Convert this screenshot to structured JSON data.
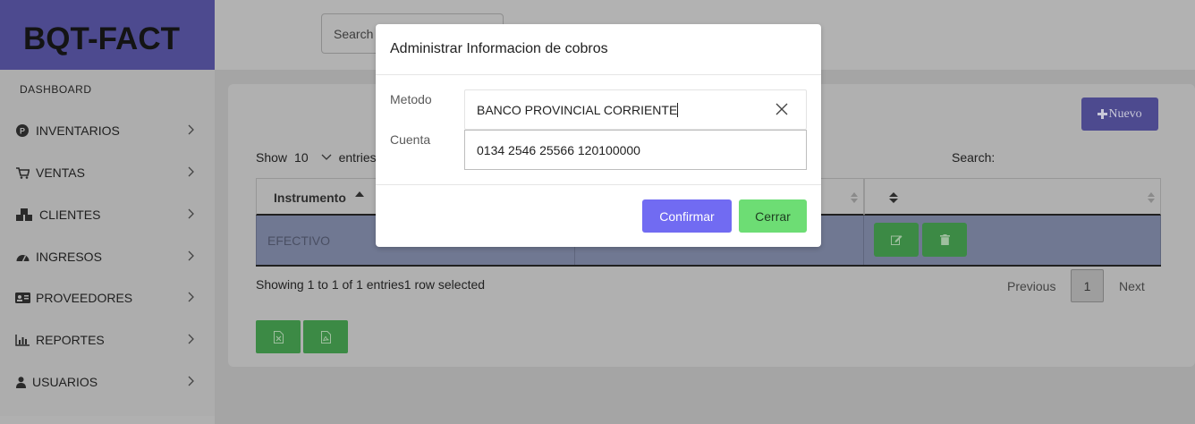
{
  "brand": "BQT-FACT",
  "sidebar": {
    "dashboard": "DASHBOARD",
    "items": [
      {
        "label": "INVENTARIOS",
        "icon": "product-hunt-icon"
      },
      {
        "label": "VENTAS",
        "icon": "cart-icon"
      },
      {
        "label": "CLIENTES",
        "icon": "cubes-icon"
      },
      {
        "label": "INGRESOS",
        "icon": "dashboard-gauge-icon"
      },
      {
        "label": "PROVEEDORES",
        "icon": "id-card-icon"
      },
      {
        "label": "REPORTES",
        "icon": "bar-chart-icon"
      },
      {
        "label": "USUARIOS",
        "icon": "user-icon"
      }
    ]
  },
  "topbar": {
    "search_placeholder": "Search"
  },
  "toolbar": {
    "new_label": "Nuevo"
  },
  "table_controls": {
    "show_label": "Show",
    "page_size": "10",
    "entries_label": "entries",
    "search_label": "Search:"
  },
  "table": {
    "columns": [
      "Instrumento",
      "",
      ""
    ],
    "rows": [
      {
        "instrumento": "EFECTIVO"
      }
    ]
  },
  "footer": {
    "info": "Showing 1 to 1 of 1 entries1 row selected",
    "previous": "Previous",
    "page": "1",
    "next": "Next"
  },
  "modal": {
    "title": "Administrar Informacion de cobros",
    "metodo_label": "Metodo",
    "metodo_value": "BANCO PROVINCIAL CORRIENTE",
    "cuenta_label": "Cuenta",
    "cuenta_value": "0134 2546 25566 120100000",
    "confirm_label": "Confirmar",
    "close_label": "Cerrar"
  },
  "colors": {
    "brand": "#4d4a8f",
    "confirm": "#716bf2",
    "close": "#6ddd74",
    "success": "#3c8a45"
  }
}
